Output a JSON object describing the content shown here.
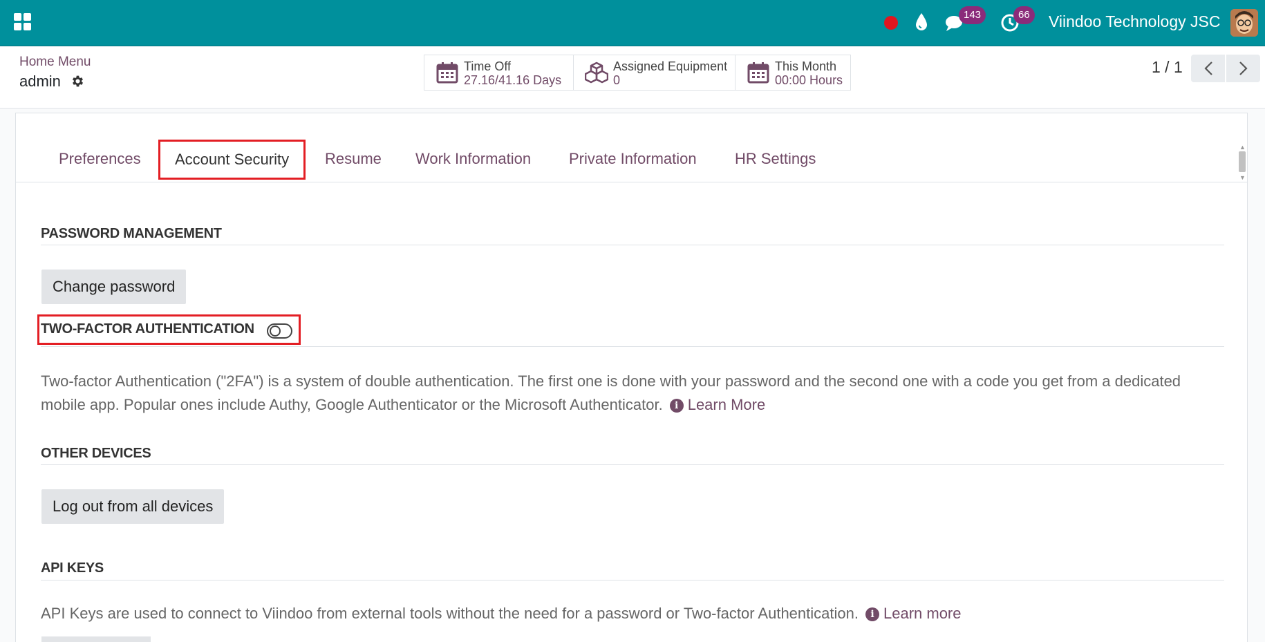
{
  "navbar": {
    "company": "Viindoo Technology JSC",
    "messages_count": "143",
    "activities_count": "66",
    "colors": {
      "bar": "#00909c",
      "badge": "#8a2b7a",
      "recording": "#e0161f"
    }
  },
  "breadcrumb": {
    "parent": "Home Menu",
    "current": "admin"
  },
  "stats": [
    {
      "label": "Time Off",
      "value": "27.16/41.16 Days",
      "icon": "calendar-icon"
    },
    {
      "label": "Assigned Equipment",
      "value": "0",
      "icon": "cubes-icon"
    },
    {
      "label": "This Month",
      "value": "00:00 Hours",
      "icon": "calendar-icon"
    }
  ],
  "pager": {
    "value": "1 / 1"
  },
  "tabs": [
    {
      "label": "Preferences"
    },
    {
      "label": "Account Security",
      "active": true
    },
    {
      "label": "Resume"
    },
    {
      "label": "Work Information"
    },
    {
      "label": "Private Information"
    },
    {
      "label": "HR Settings"
    }
  ],
  "security": {
    "password_title": "PASSWORD MANAGEMENT",
    "change_password": "Change password",
    "tfa_title": "TWO-FACTOR AUTHENTICATION",
    "tfa_desc_line1": "Two-factor Authentication (\"2FA\") is a system of double authentication. The first one is done with your password and the second one with a code you get from a dedicated",
    "tfa_desc_line2": "mobile app. Popular ones include Authy, Google Authenticator or the Microsoft Authenticator.",
    "tfa_learn": "Learn More",
    "devices_title": "OTHER DEVICES",
    "logout_all": "Log out from all devices",
    "api_title": "API KEYS",
    "api_desc": "API Keys are used to connect to Viindoo from external tools without the need for a password or Two-factor Authentication.",
    "api_learn": "Learn more"
  },
  "accent": {
    "primary": "#714b67",
    "highlight": "#e31e24"
  }
}
